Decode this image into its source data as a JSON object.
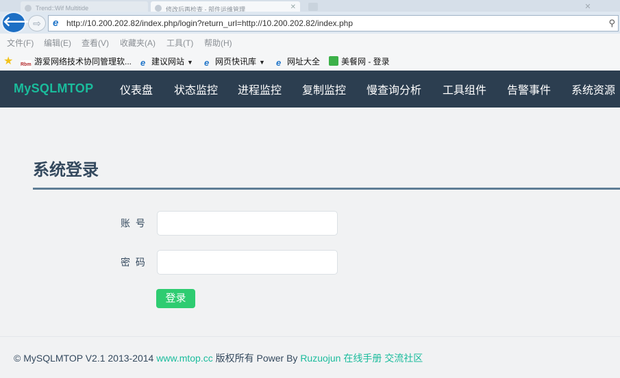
{
  "browser": {
    "tabs": [
      {
        "label": "Trend::Wif Multitide"
      },
      {
        "label": "修改后再检查 - 部件运维管理"
      }
    ],
    "url": "http://10.200.202.82/index.php/login?return_url=http://10.200.202.82/index.php",
    "menu": [
      "文件(F)",
      "编辑(E)",
      "查看(V)",
      "收藏夹(A)",
      "工具(T)",
      "帮助(H)"
    ],
    "favorites": [
      {
        "label": "游爱网络技术协同管理软...",
        "icon": "rbm-icon"
      },
      {
        "label": "建议网站",
        "icon": "ie-icon",
        "dropdown": true
      },
      {
        "label": "网页快讯库",
        "icon": "ie-icon",
        "dropdown": true
      },
      {
        "label": "网址大全",
        "icon": "ie-icon"
      },
      {
        "label": "美餐网 - 登录",
        "icon": "meican-icon"
      }
    ],
    "favorites_rbm_badge": "Rbm"
  },
  "navbar": {
    "brand": "MySQLMTOP",
    "items": [
      "仪表盘",
      "状态监控",
      "进程监控",
      "复制监控",
      "慢查询分析",
      "工具组件",
      "告警事件",
      "系统资源"
    ]
  },
  "login": {
    "title": "系统登录",
    "username_label": "账 号",
    "username_value": "",
    "password_label": "密 码",
    "password_value": "",
    "submit_label": "登录"
  },
  "footer": {
    "copyright": "© MySQLMTOP V2.1 2013-2014",
    "site_link": "www.mtop.cc",
    "rights": "版权所有 Power By",
    "author_link": "Ruzuojun",
    "manual_link": "在线手册",
    "community_link": "交流社区"
  },
  "colors": {
    "navbar_bg": "#2c3e50",
    "brand": "#1abc9c",
    "button": "#2ecc71",
    "page_bg": "#f1f2f3"
  }
}
